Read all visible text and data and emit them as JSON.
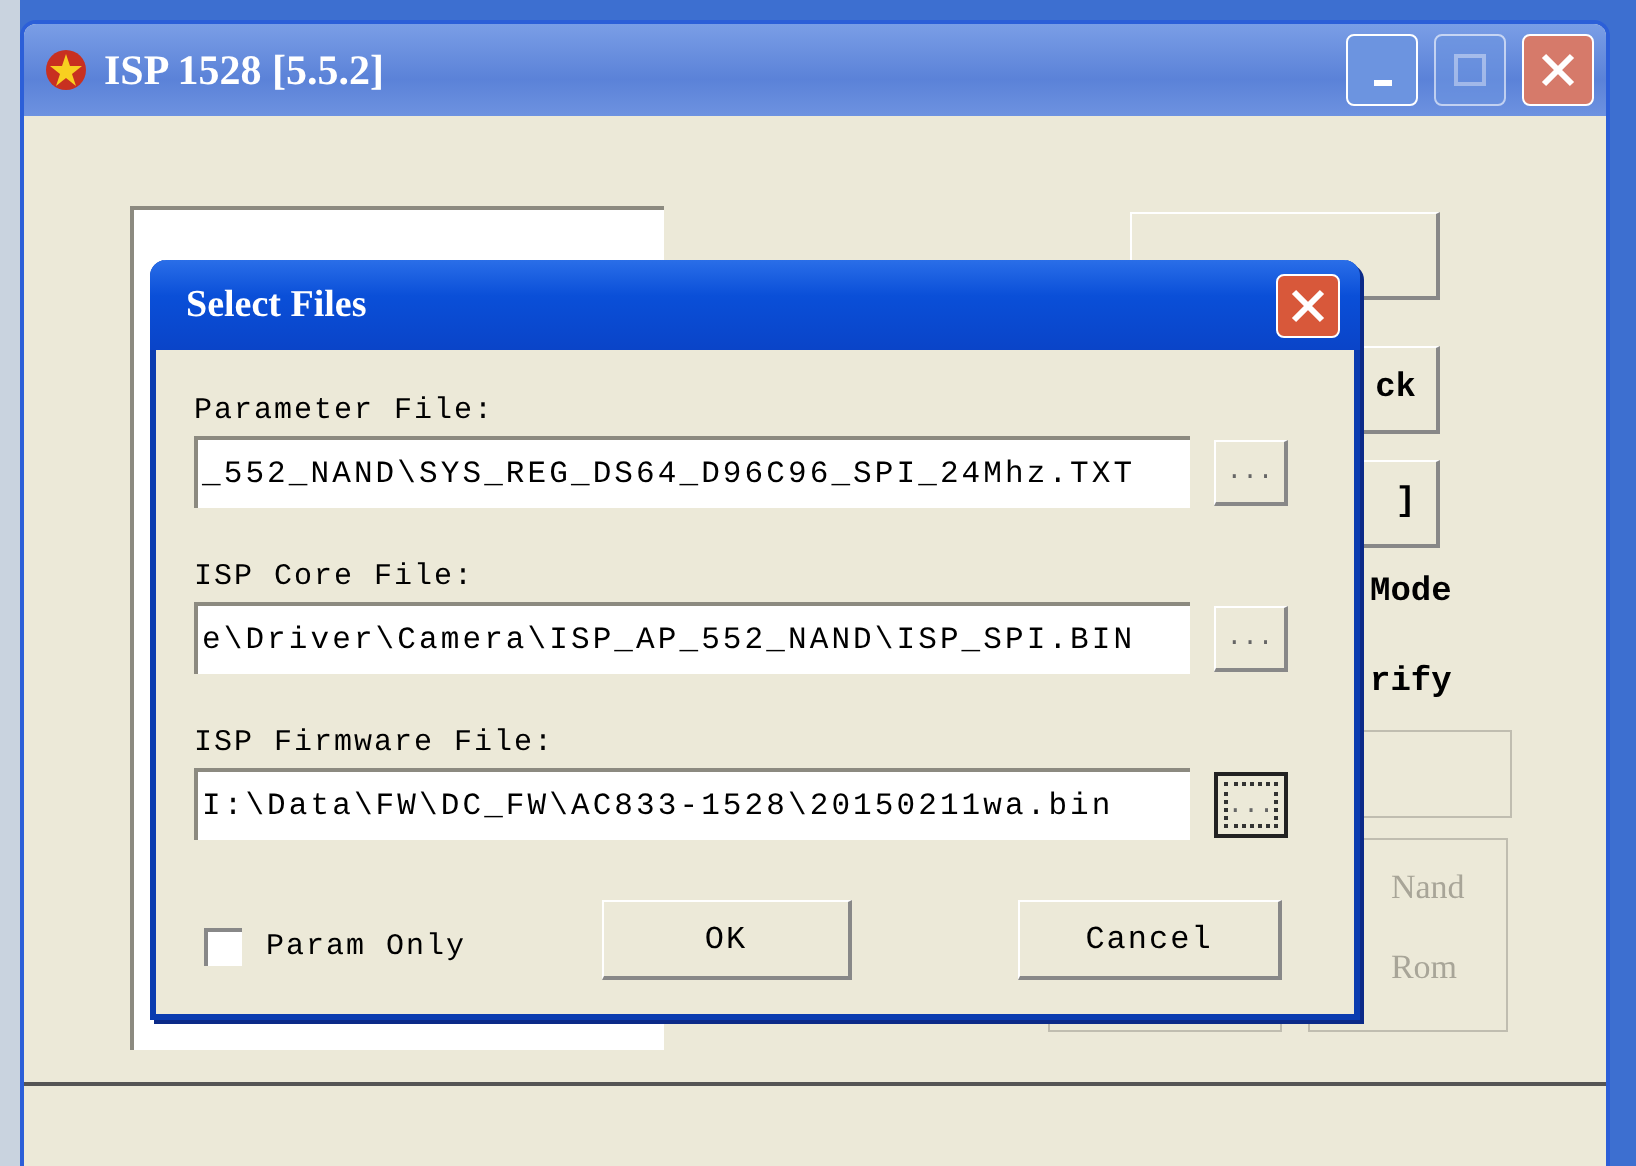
{
  "window": {
    "title": "ISP 1528 [5.5.2]"
  },
  "background_buttons": [
    {
      "label": "ck"
    },
    {
      "label": "]"
    }
  ],
  "background_options": [
    "Mode",
    "rify"
  ],
  "storage_options": [
    {
      "label": "Nand",
      "disabled": true
    },
    {
      "label": "Rom",
      "disabled": true
    }
  ],
  "dialog": {
    "title": "Select Files",
    "files": [
      {
        "label": "Parameter File:",
        "value": "_552_NAND\\SYS_REG_DS64_D96C96_SPI_24Mhz.TXT",
        "browse": "...",
        "focused": false
      },
      {
        "label": "ISP Core File:",
        "value": "e\\Driver\\Camera\\ISP_AP_552_NAND\\ISP_SPI.BIN",
        "browse": "...",
        "focused": false
      },
      {
        "label": "ISP Firmware File:",
        "value": "I:\\Data\\FW\\DC_FW\\AC833-1528\\20150211wa.bin",
        "browse": "...",
        "focused": true
      }
    ],
    "param_only": {
      "label": "Param Only",
      "checked": false
    },
    "buttons": [
      "OK",
      "Cancel"
    ]
  }
}
